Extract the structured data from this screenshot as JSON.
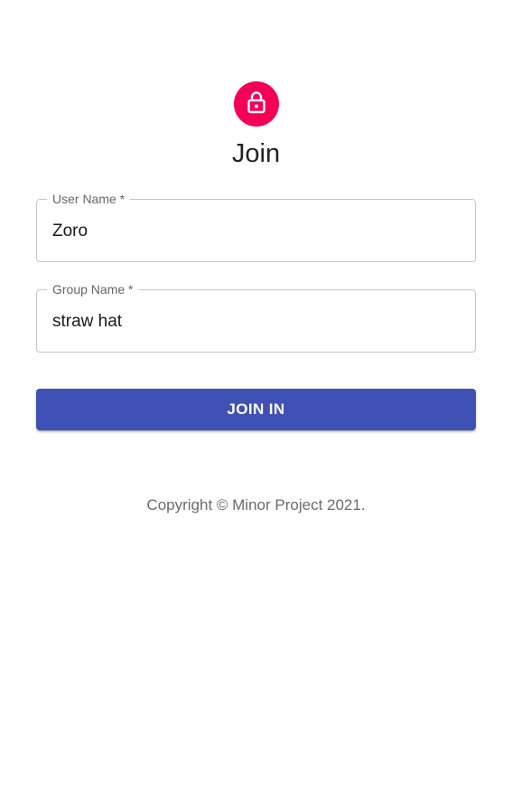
{
  "header": {
    "icon": "lock-icon",
    "title": "Join"
  },
  "form": {
    "user_name": {
      "label": "User Name *",
      "value": "Zoro"
    },
    "group_name": {
      "label": "Group Name *",
      "value": "straw hat"
    },
    "submit_label": "JOIN IN"
  },
  "footer": {
    "copyright": "Copyright © Minor Project 2021."
  },
  "colors": {
    "avatar": "#f50057",
    "button": "#3f51b5",
    "border": "#c4c4c4"
  }
}
